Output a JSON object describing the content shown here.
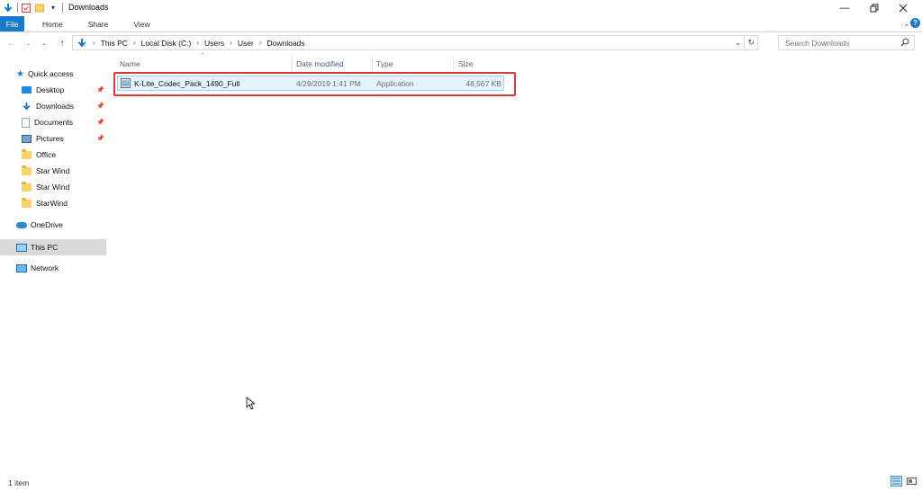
{
  "window": {
    "title": "Downloads"
  },
  "ribbon": {
    "tabs": [
      "File",
      "Home",
      "Share",
      "View"
    ]
  },
  "address": {
    "crumbs": [
      "This PC",
      "Local Disk (C:)",
      "Users",
      "User",
      "Downloads"
    ]
  },
  "search": {
    "placeholder": "Search Downloads"
  },
  "nav_pane": {
    "quick_access": "Quick access",
    "items": [
      "Desktop",
      "Downloads",
      "Documents",
      "Pictures",
      "Office",
      "Star Wind",
      "Star Wind",
      "StarWind"
    ],
    "onedrive": "OneDrive",
    "this_pc": "This PC",
    "network": "Network"
  },
  "columns": {
    "name": "Name",
    "date": "Date modified",
    "type": "Type",
    "size": "Size"
  },
  "files": [
    {
      "name": "K-Lite_Codec_Pack_1490_Full",
      "date": "4/29/2019 1:41 PM",
      "type": "Application",
      "size": "48,567 KB"
    }
  ],
  "status": {
    "count": "1 item"
  },
  "colors": {
    "accent": "#1979ca",
    "selection": "#e5f3ff",
    "highlight_box": "#d9373b"
  }
}
